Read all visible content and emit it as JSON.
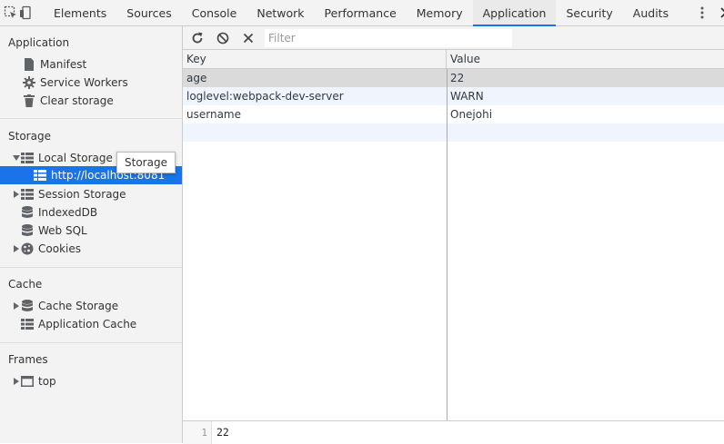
{
  "tabs": [
    {
      "label": "Elements"
    },
    {
      "label": "Sources"
    },
    {
      "label": "Console"
    },
    {
      "label": "Network"
    },
    {
      "label": "Performance"
    },
    {
      "label": "Memory"
    },
    {
      "label": "Application",
      "active": true
    },
    {
      "label": "Security"
    },
    {
      "label": "Audits"
    }
  ],
  "sidebar": {
    "application": {
      "title": "Application",
      "items": [
        {
          "label": "Manifest",
          "icon": "file-icon"
        },
        {
          "label": "Service Workers",
          "icon": "gear-icon"
        },
        {
          "label": "Clear storage",
          "icon": "trash-icon"
        }
      ]
    },
    "storage": {
      "title": "Storage",
      "local_storage": "Local Storage",
      "local_storage_child": "http://localhost:8081",
      "session_storage": "Session Storage",
      "indexeddb": "IndexedDB",
      "websql": "Web SQL",
      "cookies": "Cookies"
    },
    "cache": {
      "title": "Cache",
      "cache_storage": "Cache Storage",
      "application_cache": "Application Cache"
    },
    "frames": {
      "title": "Frames",
      "top": "top"
    },
    "tooltip": "Storage"
  },
  "toolbar": {
    "filter_placeholder": "Filter"
  },
  "table": {
    "columns": {
      "key": "Key",
      "value": "Value"
    },
    "rows": [
      {
        "key": "age",
        "value": "22",
        "selected": true
      },
      {
        "key": "loglevel:webpack-dev-server",
        "value": "WARN"
      },
      {
        "key": "username",
        "value": "Onejohi"
      },
      {
        "key": "",
        "value": ""
      }
    ]
  },
  "preview": {
    "line_number": "1",
    "value": "22"
  },
  "colors": {
    "accent": "#1a73e8",
    "selected_row": "#dadada",
    "stripe": "#f0f5fd"
  }
}
